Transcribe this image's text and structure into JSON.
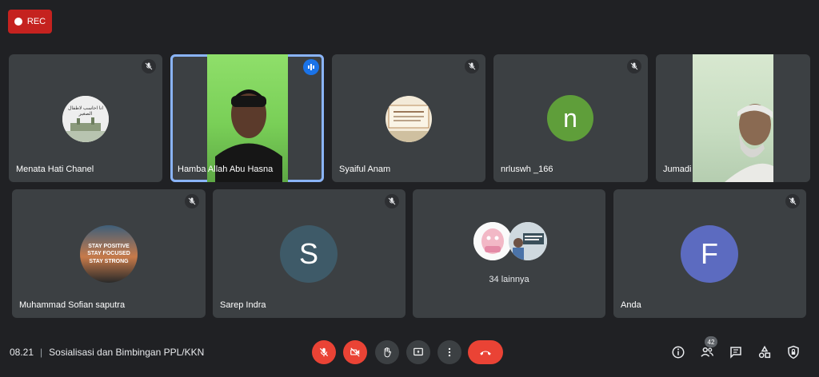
{
  "recording": {
    "label": "REC"
  },
  "participants": {
    "p1": {
      "name": "Menata Hati Chanel",
      "avatar_text": "انا احاسب لاطفال الصغير"
    },
    "p2": {
      "name": "Hamba Allah Abu Hasna"
    },
    "p3": {
      "name": "Syaiful Anam"
    },
    "p4": {
      "name": "nrluswh _166",
      "initial": "n"
    },
    "p5": {
      "name": "Jumadi"
    },
    "p6": {
      "name": "Muhammad Sofian saputra",
      "avatar_lines": [
        "STAY POSITIVE",
        "STAY FOCUSED",
        "STAY STRONG"
      ]
    },
    "p7": {
      "name": "Sarep Indra",
      "initial": "S"
    },
    "p8": {
      "more_label": "34 lainnya"
    },
    "p9": {
      "name": "Anda",
      "initial": "F"
    }
  },
  "bottom_bar": {
    "time": "08.21",
    "separator": "|",
    "meeting_title": "Sosialisasi dan Bimbingan PPL/KKN",
    "participant_count": "42"
  },
  "colors": {
    "background": "#202124",
    "tile": "#3c4043",
    "danger": "#ea4335",
    "active_outline": "#8ab4f8",
    "n_avatar": "#5f9e3a",
    "s_avatar": "#3e5a68",
    "f_avatar": "#5c6bc0"
  }
}
